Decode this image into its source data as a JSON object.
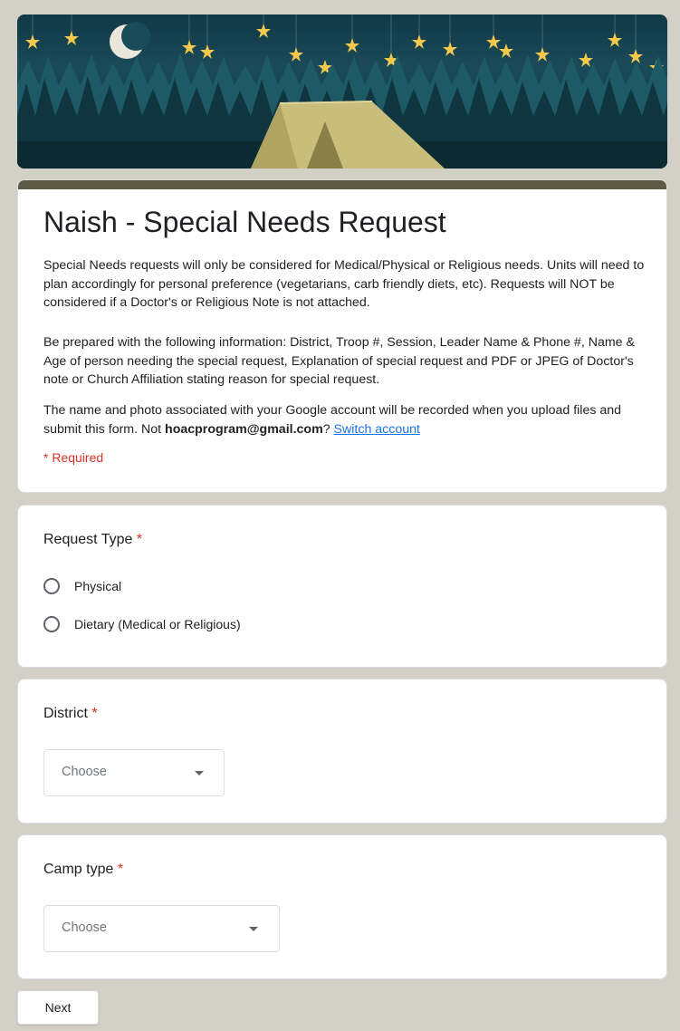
{
  "form": {
    "title": "Naish - Special Needs Request",
    "description_1": "Special Needs requests will only be considered for Medical/Physical or Religious needs. Units will need to plan accordingly for personal preference (vegetarians, carb friendly diets, etc).  Requests will NOT be considered if a Doctor's or Religious Note is not attached.",
    "description_2": "Be prepared with the following information: District, Troop #, Session, Leader Name & Phone #, Name & Age of person needing the special request, Explanation of special request and PDF or JPEG of Doctor's note or Church Affiliation stating reason for special request.",
    "account_text_before": "The name and photo associated with your Google account will be recorded when you upload files and submit this form. Not ",
    "account_email": "hoacprogram@gmail.com",
    "account_text_after": "? ",
    "switch_account_label": "Switch account",
    "required_note": "* Required"
  },
  "questions": {
    "request_type": {
      "title": "Request Type",
      "required_mark": "*",
      "options": [
        "Physical",
        "Dietary (Medical or Religious)"
      ]
    },
    "district": {
      "title": "District",
      "required_mark": "*",
      "placeholder": "Choose"
    },
    "camp_type": {
      "title": "Camp type",
      "required_mark": "*",
      "placeholder": "Choose"
    }
  },
  "actions": {
    "next_label": "Next"
  },
  "colors": {
    "accent_bar": "#5b5844",
    "required": "#d93025",
    "link": "#1a73e8",
    "page_background": "#d3d1c7"
  },
  "icons": {
    "dropdown": "arrow-drop-down-icon"
  }
}
